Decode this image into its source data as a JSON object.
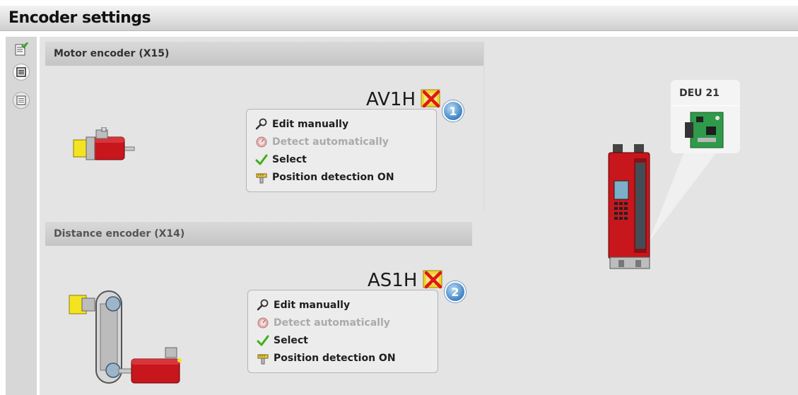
{
  "header": {
    "title": "Encoder settings"
  },
  "toolbar": {
    "buttons": [
      {
        "icon": "checklist-icon"
      },
      {
        "icon": "list-active-icon"
      },
      {
        "icon": "list-icon"
      }
    ]
  },
  "motor_encoder": {
    "section_title": "Motor encoder (X15)",
    "encoder_name": "AV1H",
    "badge": "1",
    "status_icon": "not-configured-icon",
    "actions": [
      {
        "label": "Edit manually",
        "icon": "wrench-icon",
        "enabled": true
      },
      {
        "label": "Detect automatically",
        "icon": "detect-icon",
        "enabled": false
      },
      {
        "label": "Select",
        "icon": "checkmark-icon",
        "enabled": true
      },
      {
        "label": "Position detection ON",
        "icon": "position-icon",
        "enabled": true
      }
    ]
  },
  "distance_encoder": {
    "section_title": "Distance encoder (X14)",
    "encoder_name": "AS1H",
    "badge": "2",
    "status_icon": "not-configured-icon",
    "actions": [
      {
        "label": "Edit manually",
        "icon": "wrench-icon",
        "enabled": true
      },
      {
        "label": "Detect automatically",
        "icon": "detect-icon",
        "enabled": false
      },
      {
        "label": "Select",
        "icon": "checkmark-icon",
        "enabled": true
      },
      {
        "label": "Position detection ON",
        "icon": "position-icon",
        "enabled": true
      }
    ]
  },
  "device": {
    "card_label": "DEU 21"
  },
  "colors": {
    "accent_red": "#c8161d",
    "check_green": "#3fae1b",
    "badge_blue": "#3d82c2",
    "encoder_yellow": "#f4e321"
  }
}
